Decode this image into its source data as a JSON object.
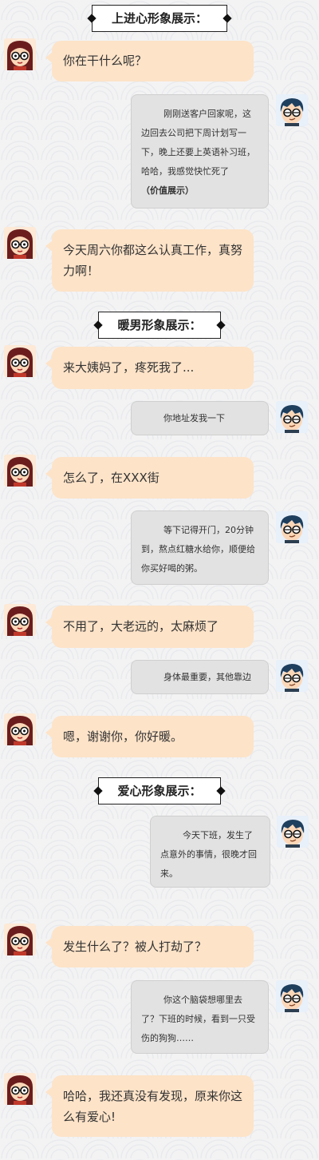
{
  "sections": {
    "s1": "上进心形象展示：",
    "s2": "暖男形象展示：",
    "s3": "爱心形象展示："
  },
  "messages": {
    "m1": "你在干什么呢？",
    "m2": "刚刚送客户回家呢，这边回去公司把下周计划写一下，晚上还要上英语补习班，哈哈，我感觉快忙死了",
    "m2_note": "（价值展示）",
    "m3": "今天周六你都这么认真工作，真努力啊！",
    "m4": "来大姨妈了，疼死我了...",
    "m5": "你地址发我一下",
    "m6": "怎么了，在XXX街",
    "m7": "等下记得开门，20分钟到，熬点红糖水给你，顺便给你买好喝的粥。",
    "m8": "不用了，大老远的，太麻烦了",
    "m9": "身体最重要，其他靠边",
    "m10": "嗯，谢谢你，你好暖。",
    "m11": "今天下班，发生了点意外的事情，很晚才回来。",
    "m12": "发生什么了？被人打劫了？",
    "m13": "你这个脑袋想哪里去了？下班的时候，看到一只受伤的狗狗……",
    "m14": "哈哈，我还真没有发现，原来你这么有爱心!"
  },
  "colors": {
    "girl_bubble": "#fde3c8",
    "boy_bubble": "#e2e2e2"
  },
  "icons": {
    "girl_avatar": "girl-with-glasses-avatar",
    "boy_avatar": "boy-with-glasses-avatar"
  }
}
